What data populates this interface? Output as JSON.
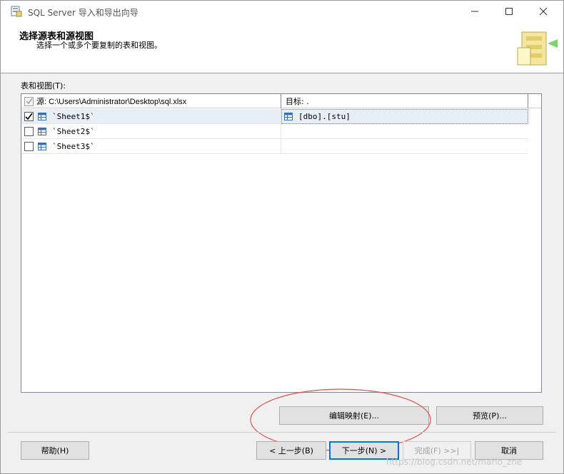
{
  "window": {
    "title": "SQL Server 导入和导出向导",
    "minimize_glyph": "—",
    "maximize_glyph": "☐",
    "close_glyph": "✕"
  },
  "header": {
    "title": "选择源表和源视图",
    "subtitle": "选择一个或多个要复制的表和视图。"
  },
  "list_label": "表和视图(T):",
  "grid": {
    "columns": {
      "source": "源: C:\\Users\\Administrator\\Desktop\\sql.xlsx",
      "destination": "目标: ."
    },
    "rows": [
      {
        "checked": true,
        "source": "`Sheet1$`",
        "destination": "[dbo].[stu]"
      },
      {
        "checked": false,
        "source": "`Sheet2$`",
        "destination": ""
      },
      {
        "checked": false,
        "source": "`Sheet3$`",
        "destination": ""
      }
    ]
  },
  "buttons": {
    "edit_mappings": "编辑映射(E)...",
    "preview": "预览(P)...",
    "help": "帮助(H)",
    "back": "< 上一步(B)",
    "next": "下一步(N) >",
    "finish": "完成(F) >>|",
    "cancel": "取消"
  },
  "watermark": "https://blog.csdn.net/mario_zhe",
  "colors": {
    "annotation_ring": "#e05050",
    "focus_border": "#0078d7",
    "selected_row": "#e8eef6"
  },
  "icons": {
    "app": "wizard-app-icon",
    "header": "wizard-header-graphic",
    "table": "table-icon",
    "check": "checkmark-icon"
  }
}
